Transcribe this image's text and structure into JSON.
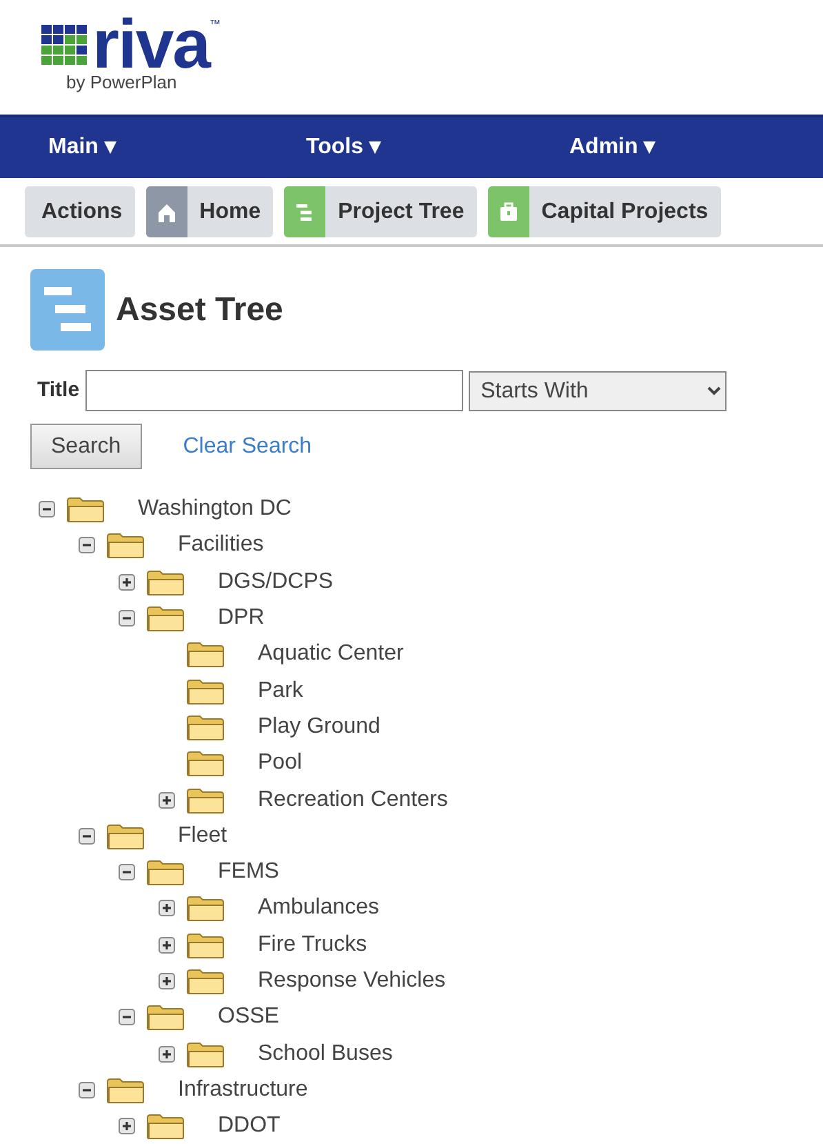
{
  "logo": {
    "name": "riva",
    "trademark": "™",
    "tagline": "by PowerPlan"
  },
  "menu": [
    {
      "label": "Main",
      "caret": "▾"
    },
    {
      "label": "Tools",
      "caret": "▾"
    },
    {
      "label": "Admin",
      "caret": "▾"
    }
  ],
  "toolbar": [
    {
      "label": "Actions",
      "kind": "plain"
    },
    {
      "label": "Home",
      "kind": "home"
    },
    {
      "label": "Project Tree",
      "kind": "tree"
    },
    {
      "label": "Capital Projects",
      "kind": "briefcase"
    }
  ],
  "page_title": "Asset Tree",
  "search": {
    "label": "Title",
    "mode": "Starts With",
    "button": "Search",
    "clear_link": "Clear Search"
  },
  "tree": [
    {
      "label": "Washington DC",
      "kind": "branch",
      "expanded": true,
      "children": [
        {
          "label": "Facilities",
          "kind": "branch",
          "expanded": true,
          "children": [
            {
              "label": "DGS/DCPS",
              "kind": "branch",
              "expanded": false
            },
            {
              "label": "DPR",
              "kind": "branch",
              "expanded": true,
              "children": [
                {
                  "label": "Aquatic Center",
                  "kind": "leaf"
                },
                {
                  "label": "Park",
                  "kind": "leaf"
                },
                {
                  "label": "Play Ground",
                  "kind": "leaf"
                },
                {
                  "label": "Pool",
                  "kind": "leaf"
                },
                {
                  "label": "Recreation Centers",
                  "kind": "branch",
                  "expanded": false
                }
              ]
            }
          ]
        },
        {
          "label": "Fleet",
          "kind": "branch",
          "expanded": true,
          "children": [
            {
              "label": "FEMS",
              "kind": "branch",
              "expanded": true,
              "children": [
                {
                  "label": "Ambulances",
                  "kind": "branch",
                  "expanded": false
                },
                {
                  "label": "Fire Trucks",
                  "kind": "branch",
                  "expanded": false
                },
                {
                  "label": "Response Vehicles",
                  "kind": "branch",
                  "expanded": false
                }
              ]
            },
            {
              "label": "OSSE",
              "kind": "branch",
              "expanded": true,
              "children": [
                {
                  "label": "School Buses",
                  "kind": "branch",
                  "expanded": false
                }
              ]
            }
          ]
        },
        {
          "label": "Infrastructure",
          "kind": "branch",
          "expanded": true,
          "children": [
            {
              "label": "DDOT",
              "kind": "branch",
              "expanded": false
            }
          ]
        }
      ]
    }
  ]
}
